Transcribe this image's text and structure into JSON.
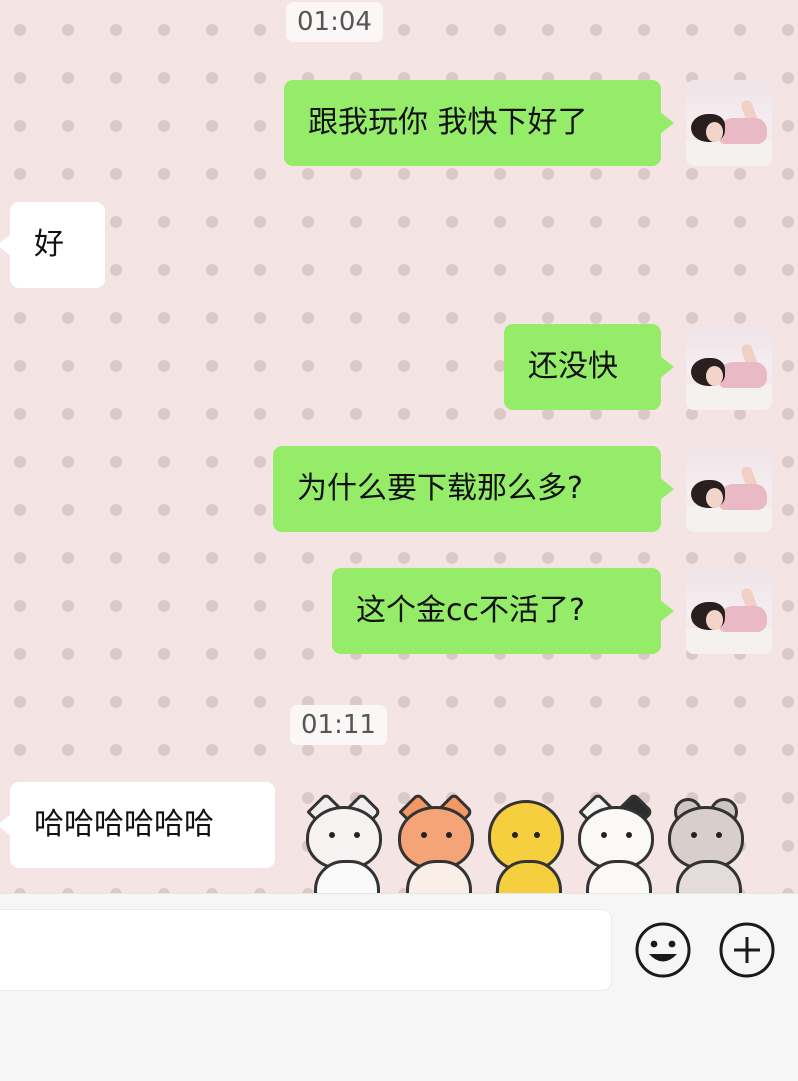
{
  "timestamps": [
    "01:04",
    "01:11"
  ],
  "messages": [
    {
      "text": "跟我玩你 我快下好了"
    },
    {
      "text": "好"
    },
    {
      "text": "还没快"
    },
    {
      "text": "为什么要下载那么多?"
    },
    {
      "text": "这个金cc不活了?"
    },
    {
      "text": "哈哈哈哈哈哈"
    }
  ],
  "input": {
    "value": ""
  },
  "icons": {
    "emoji": "smiley-face-icon",
    "more": "plus-circle-icon"
  },
  "colors": {
    "outgoing": "#95ec69",
    "incoming": "#ffffff",
    "background": "#f4e4e4"
  },
  "stickers": [
    "cat",
    "fox",
    "duck",
    "calico-cat",
    "bear"
  ]
}
